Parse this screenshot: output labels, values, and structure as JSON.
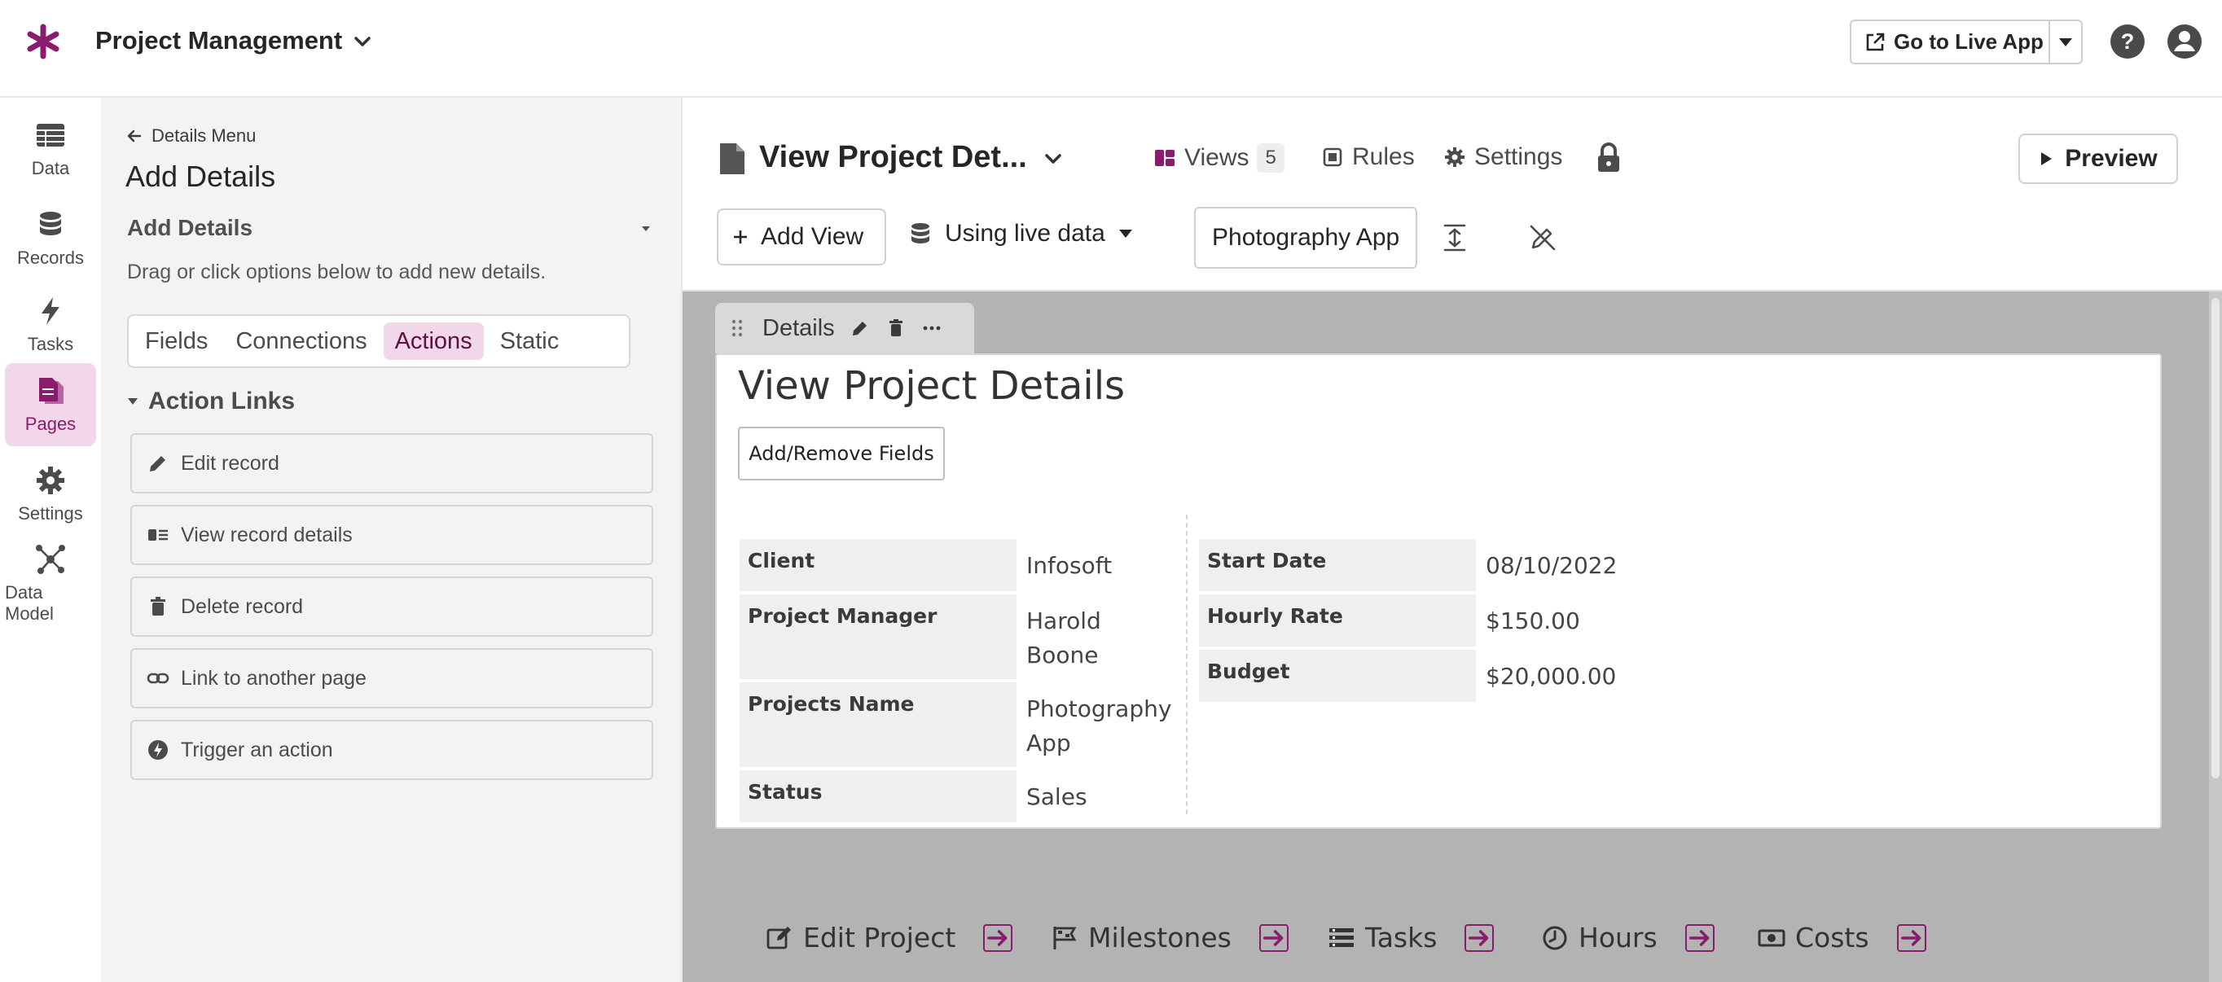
{
  "app": {
    "title": "Project Management",
    "accent": "#8a1c6d"
  },
  "topbar": {
    "live_app_label": "Go to Live App"
  },
  "nav": {
    "items": [
      {
        "label": "Data",
        "icon": "table-icon"
      },
      {
        "label": "Records",
        "icon": "database-icon"
      },
      {
        "label": "Tasks",
        "icon": "bolt-icon"
      },
      {
        "label": "Pages",
        "icon": "pages-icon",
        "active": true
      },
      {
        "label": "Settings",
        "icon": "gear-icon"
      },
      {
        "label": "Data Model",
        "icon": "data-model-icon"
      }
    ]
  },
  "panel": {
    "back_label": "Details Menu",
    "title": "Add Details",
    "section_title": "Add Details",
    "section_desc": "Drag or click options below to add new details.",
    "tabs": [
      "Fields",
      "Connections",
      "Actions",
      "Static"
    ],
    "active_tab": "Actions",
    "group_title": "Action Links",
    "actions": [
      {
        "label": "Edit record",
        "icon": "pencil-icon"
      },
      {
        "label": "View record details",
        "icon": "details-icon"
      },
      {
        "label": "Delete record",
        "icon": "trash-icon"
      },
      {
        "label": "Link to another page",
        "icon": "link-icon"
      },
      {
        "label": "Trigger an action",
        "icon": "bolt-circle-icon"
      }
    ]
  },
  "header": {
    "page_name": "View Project Det...",
    "views_label": "Views",
    "views_count": "5",
    "rules_label": "Rules",
    "settings_label": "Settings",
    "preview_label": "Preview",
    "add_view_label": "Add View",
    "data_mode_label": "Using live data",
    "record_selected": "Photography App"
  },
  "canvas": {
    "view_tab_label": "Details",
    "details_title": "View Project Details",
    "add_remove_label": "Add/Remove Fields",
    "left_fields": [
      {
        "label": "Client",
        "value": "Infosoft"
      },
      {
        "label": "Project Manager",
        "value": "Harold Boone"
      },
      {
        "label": "Projects Name",
        "value": "Photography App"
      },
      {
        "label": "Status",
        "value": "Sales"
      }
    ],
    "right_fields": [
      {
        "label": "Start Date",
        "value": "08/10/2022"
      },
      {
        "label": "Hourly Rate",
        "value": "$150.00"
      },
      {
        "label": "Budget",
        "value": "$20,000.00"
      }
    ],
    "bottom_links": [
      {
        "label": "Edit Project",
        "icon": "edit-square-icon"
      },
      {
        "label": "Milestones",
        "icon": "flag-icon"
      },
      {
        "label": "Tasks",
        "icon": "list-icon"
      },
      {
        "label": "Hours",
        "icon": "clock-icon"
      },
      {
        "label": "Costs",
        "icon": "money-icon"
      }
    ]
  }
}
